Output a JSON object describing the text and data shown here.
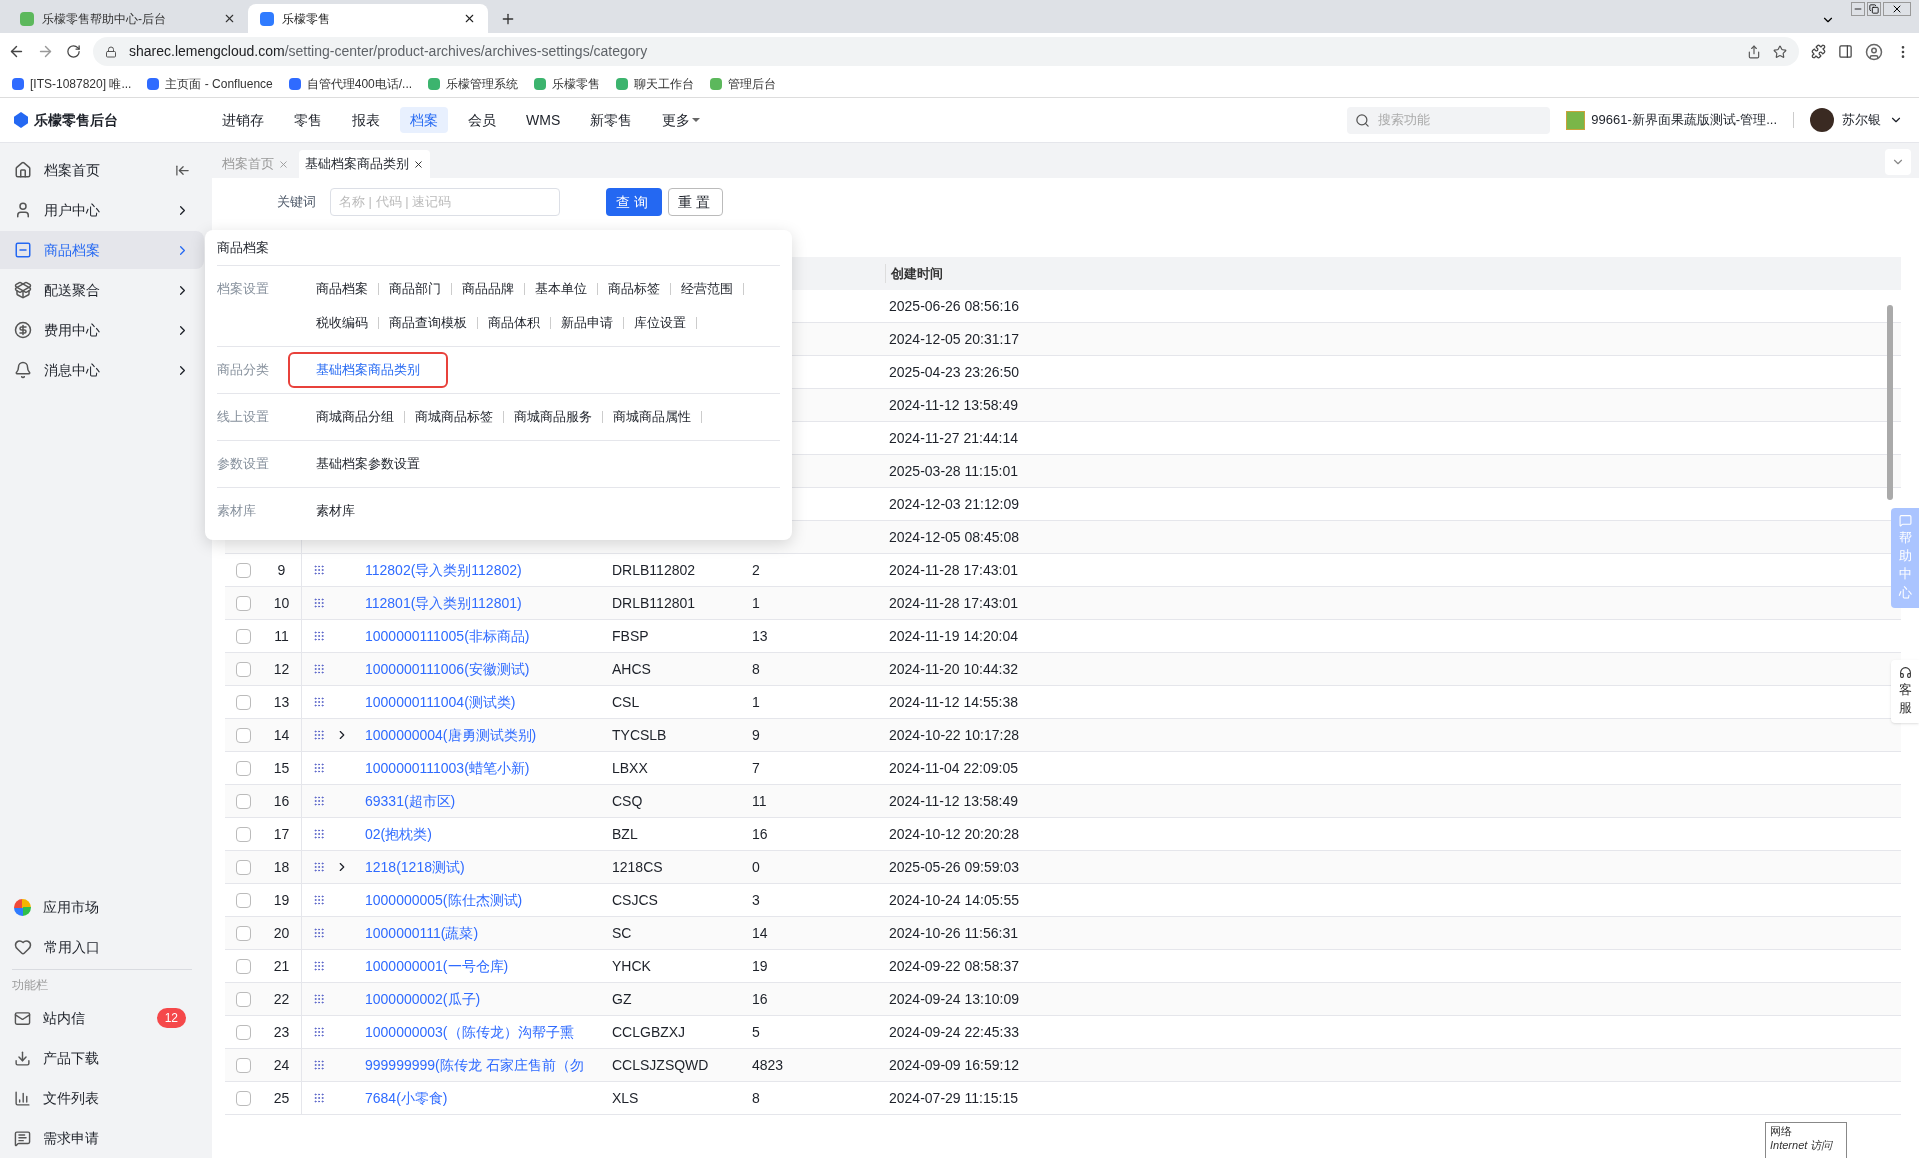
{
  "browser": {
    "tabs": [
      {
        "title": "乐檬零售帮助中心-后台",
        "selected": false
      },
      {
        "title": "乐檬零售",
        "selected": true
      }
    ],
    "url_host": "sharec.lemengcloud.com",
    "url_path": "/setting-center/product-archives/archives-settings/category",
    "bookmarks": [
      "[ITS-1087820] 唯...",
      "主页面 - Confluence",
      "自管代理400电话/...",
      "乐檬管理系统",
      "乐檬零售",
      "聊天工作台",
      "管理后台"
    ]
  },
  "header": {
    "logo": "乐檬零售后台",
    "nav": [
      {
        "label": "进销存",
        "selected": false
      },
      {
        "label": "零售",
        "selected": false
      },
      {
        "label": "报表",
        "selected": false
      },
      {
        "label": "档案",
        "selected": true
      },
      {
        "label": "会员",
        "selected": false
      },
      {
        "label": "WMS",
        "selected": false
      },
      {
        "label": "新零售",
        "selected": false
      },
      {
        "label": "更多",
        "selected": false
      }
    ],
    "search_placeholder": "搜索功能",
    "store": "99661-新界面果蔬版测试-管理...",
    "user": "苏尔银"
  },
  "sidebar": {
    "items": [
      {
        "label": "档案首页",
        "selected": false
      },
      {
        "label": "用户中心",
        "selected": false
      },
      {
        "label": "商品档案",
        "selected": true
      },
      {
        "label": "配送聚合",
        "selected": false
      },
      {
        "label": "费用中心",
        "selected": false
      },
      {
        "label": "消息中心",
        "selected": false
      }
    ],
    "bottom_items": [
      "应用市场",
      "常用入口"
    ],
    "section_label": "功能栏",
    "tools": [
      {
        "label": "站内信",
        "badge": "12"
      },
      {
        "label": "产品下载"
      },
      {
        "label": "文件列表"
      },
      {
        "label": "需求申请"
      }
    ]
  },
  "page_tabs": [
    {
      "label": "档案首页",
      "selected": false
    },
    {
      "label": "基础档案商品类别",
      "selected": true
    }
  ],
  "filter": {
    "label": "关键词",
    "placeholder": "名称 | 代码 | 速记码",
    "buttons": [
      "查询",
      "重置"
    ]
  },
  "dropdown": {
    "title": "商品档案",
    "sections": [
      {
        "label": "档案设置",
        "items": [
          {
            "label": "商品档案",
            "selected": false
          },
          {
            "label": "商品部门",
            "selected": false
          },
          {
            "label": "商品品牌",
            "selected": false
          },
          {
            "label": "基本单位",
            "selected": false
          },
          {
            "label": "商品标签",
            "selected": false
          },
          {
            "label": "经营范围",
            "selected": false
          },
          {
            "label": "税收编码",
            "selected": false
          },
          {
            "label": "商品查询模板",
            "selected": false
          },
          {
            "label": "商品体积",
            "selected": false
          },
          {
            "label": "新品申请",
            "selected": false
          },
          {
            "label": "库位设置",
            "selected": false
          }
        ]
      },
      {
        "label": "商品分类",
        "items": [
          {
            "label": "基础档案商品类别",
            "selected": true
          }
        ]
      },
      {
        "label": "线上设置",
        "items": [
          {
            "label": "商城商品分组",
            "selected": false
          },
          {
            "label": "商城商品标签",
            "selected": false
          },
          {
            "label": "商城商品服务",
            "selected": false
          },
          {
            "label": "商城商品属性",
            "selected": false
          }
        ]
      },
      {
        "label": "参数设置",
        "items": [
          {
            "label": "基础档案参数设置",
            "selected": false
          }
        ]
      },
      {
        "label": "素材库",
        "items": [
          {
            "label": "素材库",
            "selected": false
          }
        ]
      }
    ]
  },
  "table": {
    "columns": [
      "创建时间"
    ],
    "rows": [
      {
        "created": "2025-06-26 08:56:16"
      },
      {
        "created": "2024-12-05 20:31:17"
      },
      {
        "created": "2025-04-23 23:26:50"
      },
      {
        "created": "2024-11-12 13:58:49"
      },
      {
        "created": "2024-11-27 21:44:14"
      },
      {
        "created": "2025-03-28 11:15:01"
      },
      {
        "created": "2024-12-03 21:12:09"
      },
      {
        "created": "2024-12-05 08:45:08"
      },
      {
        "index": "9",
        "checked": false,
        "has_children": false,
        "name": "112802(导入类别112802)",
        "code": "DRLB112802",
        "count": "2",
        "created": "2024-11-28 17:43:01"
      },
      {
        "index": "10",
        "checked": false,
        "has_children": false,
        "name": "112801(导入类别112801)",
        "code": "DRLB112801",
        "count": "1",
        "created": "2024-11-28 17:43:01"
      },
      {
        "index": "11",
        "checked": false,
        "has_children": false,
        "name": "1000000111005(非标商品)",
        "code": "FBSP",
        "count": "13",
        "created": "2024-11-19 14:20:04"
      },
      {
        "index": "12",
        "checked": false,
        "has_children": false,
        "name": "1000000111006(安徽测试)",
        "code": "AHCS",
        "count": "8",
        "created": "2024-11-20 10:44:32"
      },
      {
        "index": "13",
        "checked": false,
        "has_children": false,
        "name": "1000000111004(测试类)",
        "code": "CSL",
        "count": "1",
        "created": "2024-11-12 14:55:38"
      },
      {
        "index": "14",
        "checked": false,
        "has_children": true,
        "name": "1000000004(唐勇测试类别)",
        "code": "TYCSLB",
        "count": "9",
        "created": "2024-10-22 10:17:28"
      },
      {
        "index": "15",
        "checked": false,
        "has_children": false,
        "name": "1000000111003(蜡笔小新)",
        "code": "LBXX",
        "count": "7",
        "created": "2024-11-04 22:09:05"
      },
      {
        "index": "16",
        "checked": false,
        "has_children": false,
        "name": "69331(超市区)",
        "code": "CSQ",
        "count": "11",
        "created": "2024-11-12 13:58:49"
      },
      {
        "index": "17",
        "checked": false,
        "has_children": false,
        "name": "02(抱枕类)",
        "code": "BZL",
        "count": "16",
        "created": "2024-10-12 20:20:28"
      },
      {
        "index": "18",
        "checked": false,
        "has_children": true,
        "name": "1218(1218测试)",
        "code": "1218CS",
        "count": "0",
        "created": "2025-05-26 09:59:03"
      },
      {
        "index": "19",
        "checked": false,
        "has_children": false,
        "name": "1000000005(陈仕杰测试)",
        "code": "CSJCS",
        "count": "3",
        "created": "2024-10-24 14:05:55"
      },
      {
        "index": "20",
        "checked": false,
        "has_children": false,
        "name": "1000000111(蔬菜)",
        "code": "SC",
        "count": "14",
        "created": "2024-10-26 11:56:31"
      },
      {
        "index": "21",
        "checked": false,
        "has_children": false,
        "name": "1000000001(一号仓库)",
        "code": "YHCK",
        "count": "19",
        "created": "2024-09-22 08:58:37"
      },
      {
        "index": "22",
        "checked": false,
        "has_children": false,
        "name": "1000000002(瓜子)",
        "code": "GZ",
        "count": "16",
        "created": "2024-09-24 13:10:09"
      },
      {
        "index": "23",
        "checked": false,
        "has_children": false,
        "name": "1000000003(（陈传龙）沟帮子熏",
        "code": "CCLGBZXJ",
        "count": "5",
        "created": "2024-09-24 22:45:33"
      },
      {
        "index": "24",
        "checked": false,
        "has_children": false,
        "name": "999999999(陈传龙 石家庄售前（勿",
        "code": "CCLSJZSQWD",
        "count": "4823",
        "created": "2024-09-09 16:59:12"
      },
      {
        "index": "25",
        "checked": false,
        "has_children": false,
        "name": "7684(小零食)",
        "code": "XLS",
        "count": "8",
        "created": "2024-07-29 11:15:15"
      }
    ]
  },
  "float": {
    "help": "帮助中心",
    "service": "客服"
  },
  "tooltip": {
    "line1": "网络",
    "line2": "Internet 访问"
  }
}
